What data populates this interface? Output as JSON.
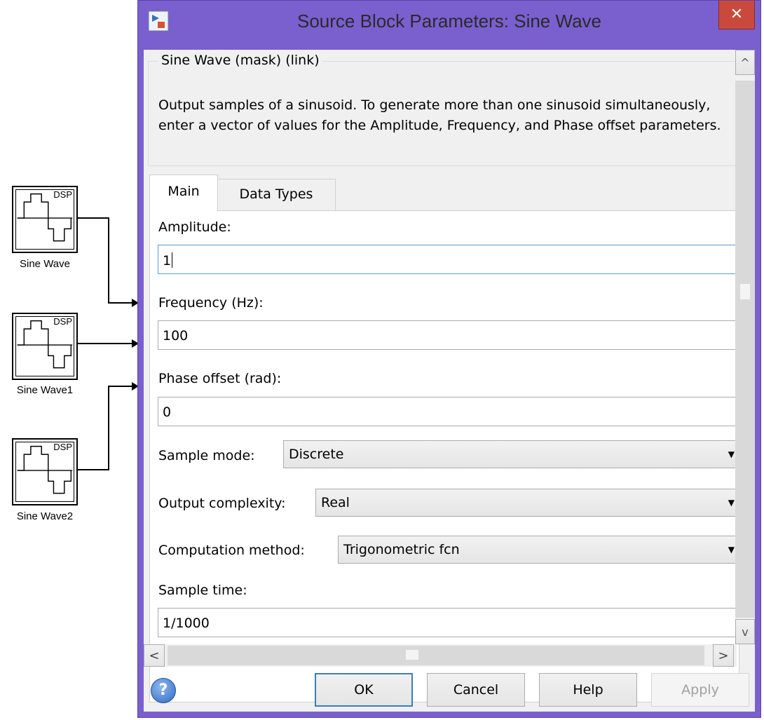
{
  "canvas": {
    "blocks": [
      {
        "icon_text": "DSP",
        "label": "Sine Wave"
      },
      {
        "icon_text": "DSP",
        "label": "Sine Wave1"
      },
      {
        "icon_text": "DSP",
        "label": "Sine Wave2"
      }
    ]
  },
  "dialog": {
    "title": "Source Block Parameters: Sine Wave",
    "close_glyph": "✕",
    "group_title": "Sine Wave (mask) (link)",
    "description": "Output samples of a sinusoid.  To generate more than one sinusoid simultaneously, enter a vector of values for the Amplitude, Frequency, and Phase offset parameters.",
    "tabs": [
      {
        "label": "Main",
        "active": true
      },
      {
        "label": "Data Types",
        "active": false
      }
    ],
    "fields": {
      "amplitude": {
        "label": "Amplitude:",
        "value": "1"
      },
      "frequency": {
        "label": "Frequency (Hz):",
        "value": "100"
      },
      "phase": {
        "label": "Phase offset (rad):",
        "value": "0"
      },
      "sample_mode": {
        "label": "Sample mode:",
        "value": "Discrete"
      },
      "output_complexity": {
        "label": "Output complexity:",
        "value": "Real"
      },
      "computation_method": {
        "label": "Computation method:",
        "value": "Trigonometric fcn"
      },
      "sample_time": {
        "label": "Sample time:",
        "value": "1/1000"
      }
    },
    "buttons": {
      "ok": "OK",
      "cancel": "Cancel",
      "help": "Help",
      "apply": "Apply"
    },
    "help_icon_glyph": "?",
    "scroll_glyphs": {
      "up": "^",
      "down": "v",
      "left": "<",
      "right": ">"
    },
    "colors": {
      "title_bar": "#7a5fcf",
      "close_button": "#c94a3d",
      "focus_border": "#5b9bd5"
    }
  }
}
